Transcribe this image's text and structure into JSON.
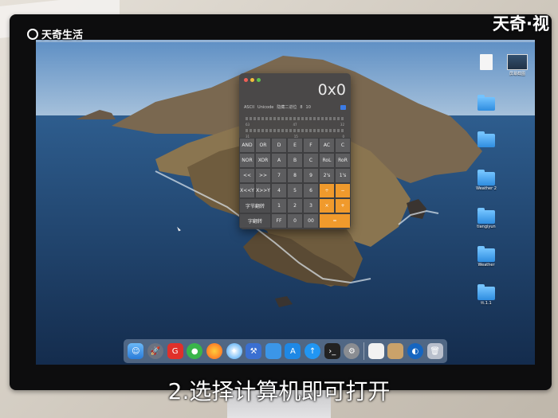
{
  "watermark_left": "天奇生活",
  "watermark_right": "天奇·视",
  "subtitle": "2.选择计算机即可打开",
  "calculator": {
    "display": "0x0",
    "modes": [
      "ASCII",
      "Unicode",
      "隐藏二进位",
      "8",
      "10",
      "16"
    ],
    "bit_positions": [
      "63",
      "47",
      "32",
      "31",
      "15",
      "0"
    ],
    "keys": [
      "AND",
      "OR",
      "D",
      "E",
      "F",
      "AC",
      "C",
      "NOR",
      "XOR",
      "A",
      "B",
      "C",
      "RoL",
      "RoR",
      "<<",
      ">>",
      "7",
      "8",
      "9",
      "2's",
      "1's",
      "X<<Y",
      "X>>Y",
      "4",
      "5",
      "6",
      "÷",
      "−",
      "字节翻转",
      "",
      "1",
      "2",
      "3",
      "×",
      "+",
      "字翻转",
      "",
      "FF",
      "0",
      "00",
      "="
    ]
  },
  "desktop_icons": [
    {
      "label": "",
      "type": "doc"
    },
    {
      "label": "屏幕截图",
      "type": "thumb"
    },
    {
      "label": "",
      "type": "folder"
    },
    {
      "label": "",
      "type": "folder"
    },
    {
      "label": "Weather 2",
      "type": "folder"
    },
    {
      "label": "tiangiyun",
      "type": "folder"
    },
    {
      "label": "Weather",
      "type": "folder"
    },
    {
      "label": "tt.1.1",
      "type": "folder"
    }
  ],
  "dock": [
    "finder-icon",
    "launchpad-icon",
    "app-red-icon",
    "wechat-icon",
    "firefox-icon",
    "safari-icon",
    "xcode-icon",
    "folder-icon",
    "appstore-icon",
    "upload-icon",
    "terminal-icon",
    "settings-icon",
    "notes-icon",
    "preview-icon",
    "browser-icon",
    "trash-icon"
  ],
  "colors": {
    "accent": "#f09a2c",
    "folder": "#3b96e8"
  }
}
